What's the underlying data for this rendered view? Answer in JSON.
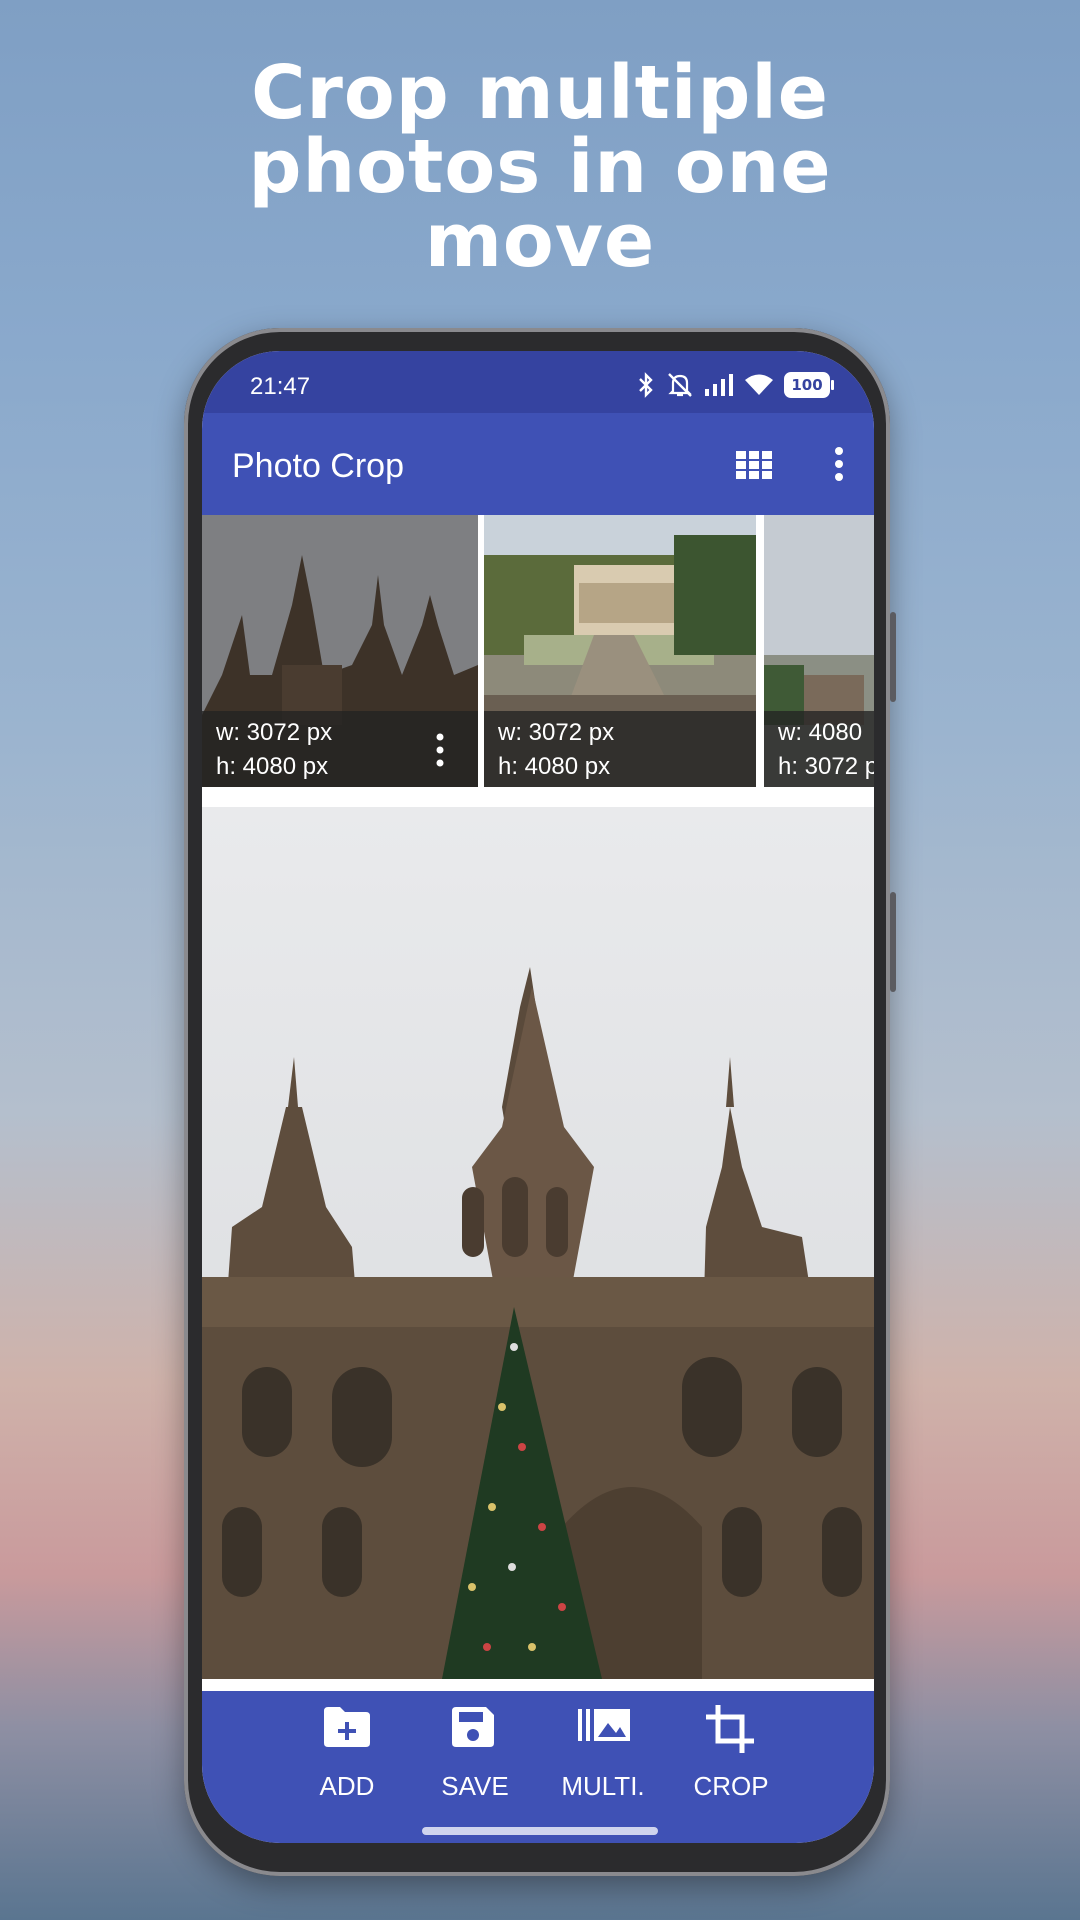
{
  "promo": {
    "headline_lines": [
      "Crop multiple",
      "photos in one",
      "move"
    ]
  },
  "status_bar": {
    "time": "21:47",
    "battery": "100",
    "icons": [
      "bluetooth-icon",
      "bell-muted-icon",
      "signal-icon",
      "wifi-icon",
      "battery-icon"
    ]
  },
  "app_bar": {
    "title": "Photo Crop",
    "actions": [
      "grid-view-icon",
      "overflow-menu-icon"
    ]
  },
  "thumbnails": [
    {
      "width_label": "w: 3072 px",
      "height_label": "h: 4080 px",
      "subject": "cathedral"
    },
    {
      "width_label": "w: 3072 px",
      "height_label": "h: 4080 px",
      "subject": "park"
    },
    {
      "width_label": "w: 4080",
      "height_label": "h: 3072 p",
      "subject": "city"
    }
  ],
  "bottom_actions": [
    {
      "label": "ADD",
      "icon": "folder-add-icon"
    },
    {
      "label": "SAVE",
      "icon": "save-icon"
    },
    {
      "label": "MULTI.",
      "icon": "multi-image-icon"
    },
    {
      "label": "CROP",
      "icon": "crop-icon"
    }
  ],
  "colors": {
    "primary": "#3f51b5",
    "status_bar": "#3543a0",
    "text_on_primary": "#ffffff"
  }
}
